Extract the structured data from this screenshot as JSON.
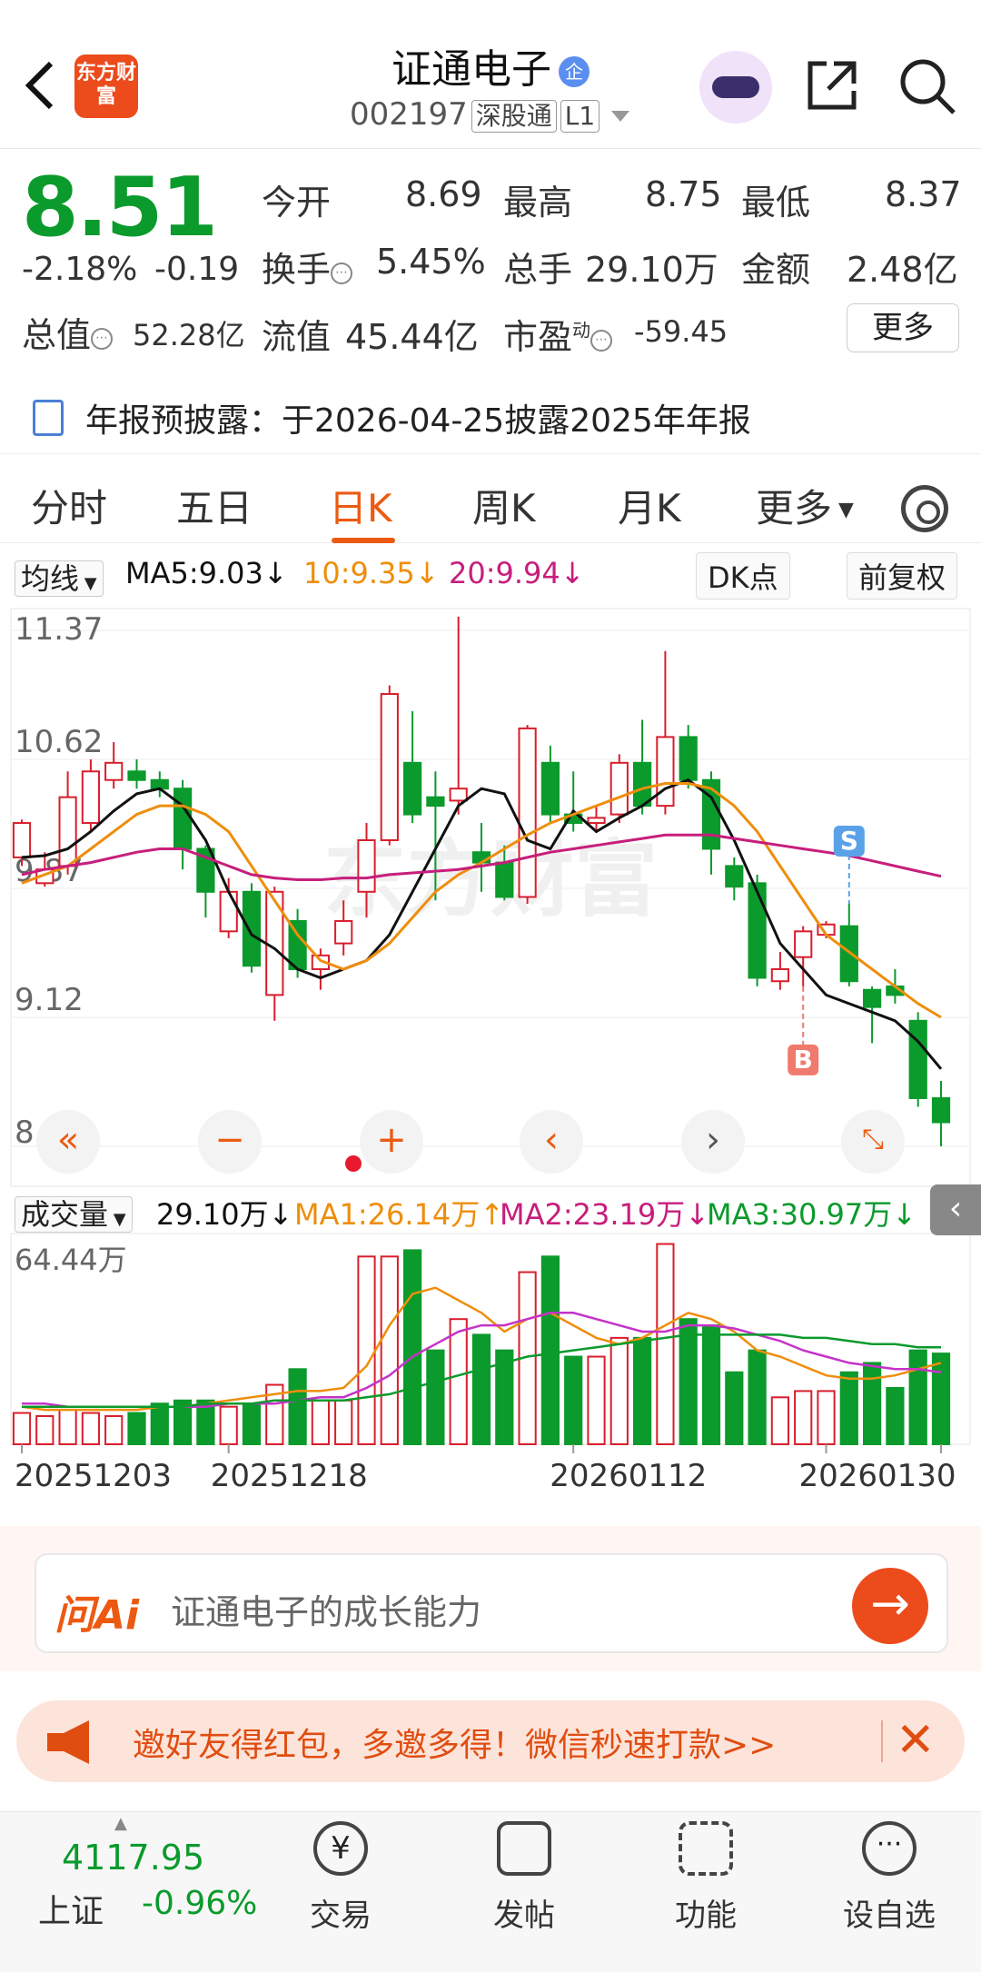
{
  "header": {
    "back_glyph": "back-icon",
    "logo_text": "东方财富",
    "stock_name": "证通电子",
    "qi_badge": "企",
    "stock_code": "002197",
    "market_tag": "深股通",
    "level_tag": "L1"
  },
  "quote": {
    "price": "8.51",
    "change_pct": "-2.18%",
    "change": "-0.19",
    "fields": {
      "open_label": "今开",
      "open": "8.69",
      "high_label": "最高",
      "high": "8.75",
      "low_label": "最低",
      "low": "8.37",
      "turnover_label": "换手",
      "turnover": "5.45%",
      "volume_label": "总手",
      "volume": "29.10万",
      "amount_label": "金额",
      "amount": "2.48亿",
      "mktcap_label": "总值",
      "mktcap": "52.28亿",
      "float_label": "流值",
      "float": "45.44亿",
      "pe_label": "市盈",
      "pe_sup": "动",
      "pe": "-59.45"
    },
    "more_label": "更多"
  },
  "notice": {
    "text": "年报预披露：于2026-04-25披露2025年年报"
  },
  "tabs": [
    "分时",
    "五日",
    "日K",
    "周K",
    "月K",
    "更多"
  ],
  "ma_row": {
    "selector": "均线",
    "ma5": "MA5:9.03↓",
    "ma10": "10:9.35↓",
    "ma20": "20:9.94↓",
    "dk": "DK点",
    "adjust": "前复权"
  },
  "vol_row": {
    "selector": "成交量",
    "vol": "29.10万↓",
    "ma1": "MA1:26.14万↑",
    "ma2": "MA2:23.19万↓",
    "ma3": "MA3:30.97万↓"
  },
  "chart_data": {
    "type": "candlestick",
    "y_axis_labels": [
      "11.37",
      "10.62",
      "9.87",
      "9.12",
      "8.37"
    ],
    "ylim": [
      8.37,
      11.37
    ],
    "volume_axis_label": "64.44万",
    "volume_max": 64.44,
    "x_labels": [
      "20251203",
      "20251218",
      "20260112",
      "20260130"
    ],
    "markers": [
      {
        "label": "S"
      },
      {
        "label": "B"
      }
    ],
    "candles": [
      {
        "o": 10.05,
        "c": 10.25,
        "h": 10.27,
        "l": 10.0,
        "v": 10
      },
      {
        "o": 9.9,
        "c": 9.98,
        "h": 10.08,
        "l": 9.88,
        "v": 9
      },
      {
        "o": 10.0,
        "c": 10.4,
        "h": 10.55,
        "l": 9.95,
        "v": 11
      },
      {
        "o": 10.25,
        "c": 10.55,
        "h": 10.62,
        "l": 10.2,
        "v": 10
      },
      {
        "o": 10.5,
        "c": 10.6,
        "h": 10.72,
        "l": 10.45,
        "v": 9
      },
      {
        "o": 10.55,
        "c": 10.5,
        "h": 10.62,
        "l": 10.45,
        "v": 10
      },
      {
        "o": 10.5,
        "c": 10.45,
        "h": 10.55,
        "l": 10.4,
        "v": 13
      },
      {
        "o": 10.45,
        "c": 10.1,
        "h": 10.5,
        "l": 9.98,
        "v": 14
      },
      {
        "o": 10.1,
        "c": 9.85,
        "h": 10.12,
        "l": 9.7,
        "v": 14
      },
      {
        "o": 9.62,
        "c": 9.85,
        "h": 9.93,
        "l": 9.58,
        "v": 12
      },
      {
        "o": 9.85,
        "c": 9.42,
        "h": 9.9,
        "l": 9.38,
        "v": 13
      },
      {
        "o": 9.25,
        "c": 9.85,
        "h": 9.88,
        "l": 9.1,
        "v": 19
      },
      {
        "o": 9.68,
        "c": 9.4,
        "h": 9.75,
        "l": 9.35,
        "v": 24
      },
      {
        "o": 9.4,
        "c": 9.48,
        "h": 9.52,
        "l": 9.28,
        "v": 14
      },
      {
        "o": 9.55,
        "c": 9.68,
        "h": 9.8,
        "l": 9.48,
        "v": 14
      },
      {
        "o": 9.85,
        "c": 10.15,
        "h": 10.25,
        "l": 9.7,
        "v": 60
      },
      {
        "o": 10.15,
        "c": 11.0,
        "h": 11.05,
        "l": 10.12,
        "v": 60
      },
      {
        "o": 10.6,
        "c": 10.3,
        "h": 10.9,
        "l": 10.25,
        "v": 62
      },
      {
        "o": 10.4,
        "c": 10.35,
        "h": 10.55,
        "l": 9.8,
        "v": 30
      },
      {
        "o": 10.38,
        "c": 10.45,
        "h": 11.45,
        "l": 10.3,
        "v": 40
      },
      {
        "o": 10.08,
        "c": 10.02,
        "h": 10.25,
        "l": 9.85,
        "v": 35
      },
      {
        "o": 10.02,
        "c": 9.82,
        "h": 10.12,
        "l": 9.8,
        "v": 30
      },
      {
        "o": 9.82,
        "c": 10.8,
        "h": 10.82,
        "l": 9.78,
        "v": 55
      },
      {
        "o": 10.6,
        "c": 10.3,
        "h": 10.7,
        "l": 10.25,
        "v": 60
      },
      {
        "o": 10.3,
        "c": 10.25,
        "h": 10.55,
        "l": 10.2,
        "v": 28
      },
      {
        "o": 10.25,
        "c": 10.28,
        "h": 10.35,
        "l": 10.2,
        "v": 28
      },
      {
        "o": 10.3,
        "c": 10.6,
        "h": 10.65,
        "l": 10.25,
        "v": 34
      },
      {
        "o": 10.6,
        "c": 10.35,
        "h": 10.85,
        "l": 10.3,
        "v": 34
      },
      {
        "o": 10.35,
        "c": 10.75,
        "h": 11.25,
        "l": 10.3,
        "v": 64
      },
      {
        "o": 10.75,
        "c": 10.5,
        "h": 10.82,
        "l": 10.45,
        "v": 40
      },
      {
        "o": 10.5,
        "c": 10.1,
        "h": 10.55,
        "l": 9.95,
        "v": 38
      },
      {
        "o": 10.0,
        "c": 9.88,
        "h": 10.05,
        "l": 9.8,
        "v": 23
      },
      {
        "o": 9.9,
        "c": 9.35,
        "h": 9.95,
        "l": 9.3,
        "v": 30
      },
      {
        "o": 9.33,
        "c": 9.4,
        "h": 9.5,
        "l": 9.28,
        "v": 15
      },
      {
        "o": 9.47,
        "c": 9.62,
        "h": 9.65,
        "l": 9.3,
        "v": 17
      },
      {
        "o": 9.6,
        "c": 9.66,
        "h": 9.68,
        "l": 9.58,
        "v": 17
      },
      {
        "o": 9.65,
        "c": 9.33,
        "h": 9.78,
        "l": 9.3,
        "v": 23
      },
      {
        "o": 9.28,
        "c": 9.18,
        "h": 9.3,
        "l": 8.97,
        "v": 26
      },
      {
        "o": 9.3,
        "c": 9.25,
        "h": 9.4,
        "l": 9.2,
        "v": 18
      },
      {
        "o": 9.1,
        "c": 8.65,
        "h": 9.15,
        "l": 8.6,
        "v": 30
      },
      {
        "o": 8.65,
        "c": 8.51,
        "h": 8.75,
        "l": 8.37,
        "v": 29
      }
    ],
    "ma5": [
      10.05,
      10.06,
      10.1,
      10.2,
      10.32,
      10.42,
      10.45,
      10.35,
      10.15,
      9.85,
      9.6,
      9.52,
      9.4,
      9.35,
      9.4,
      9.45,
      9.6,
      9.85,
      10.1,
      10.35,
      10.45,
      10.42,
      10.15,
      10.1,
      10.32,
      10.2,
      10.28,
      10.35,
      10.45,
      10.5,
      10.4,
      10.15,
      9.85,
      9.55,
      9.4,
      9.25,
      9.2,
      9.15,
      9.1,
      8.98,
      8.82
    ],
    "ma10": [
      9.9,
      9.95,
      10.0,
      10.1,
      10.2,
      10.3,
      10.35,
      10.35,
      10.3,
      10.2,
      10.0,
      9.8,
      9.6,
      9.45,
      9.4,
      9.45,
      9.55,
      9.7,
      9.85,
      9.95,
      10.02,
      10.1,
      10.18,
      10.25,
      10.3,
      10.35,
      10.4,
      10.45,
      10.48,
      10.48,
      10.45,
      10.35,
      10.2,
      10.0,
      9.8,
      9.6,
      9.5,
      9.4,
      9.3,
      9.2,
      9.12
    ],
    "ma20": [
      9.95,
      9.98,
      10.0,
      10.02,
      10.05,
      10.08,
      10.1,
      10.1,
      10.05,
      10.0,
      9.95,
      9.93,
      9.92,
      9.92,
      9.93,
      9.93,
      9.95,
      9.96,
      9.97,
      9.98,
      10.0,
      10.02,
      10.05,
      10.08,
      10.1,
      10.12,
      10.14,
      10.16,
      10.18,
      10.18,
      10.18,
      10.16,
      10.14,
      10.12,
      10.1,
      10.08,
      10.06,
      10.03,
      10.0,
      9.97,
      9.94
    ],
    "vma1": [
      12,
      11,
      11,
      11,
      11,
      11,
      12,
      12,
      13,
      14,
      15,
      16,
      17,
      17,
      18,
      25,
      38,
      48,
      50,
      46,
      42,
      36,
      40,
      42,
      38,
      34,
      32,
      34,
      38,
      42,
      40,
      36,
      30,
      28,
      25,
      22,
      21,
      21,
      22,
      24,
      26
    ],
    "vma2": [
      13,
      13,
      12,
      12,
      12,
      12,
      12,
      12,
      12,
      13,
      13,
      13,
      14,
      15,
      15,
      18,
      22,
      28,
      32,
      36,
      38,
      38,
      40,
      42,
      42,
      40,
      38,
      36,
      36,
      38,
      38,
      37,
      35,
      33,
      30,
      28,
      26,
      25,
      24,
      24,
      23
    ],
    "vma3": [
      12,
      12,
      12,
      12,
      12,
      12,
      12,
      12,
      13,
      13,
      13,
      14,
      14,
      14,
      14,
      15,
      16,
      18,
      20,
      22,
      24,
      26,
      28,
      29,
      30,
      31,
      32,
      33,
      34,
      35,
      35,
      35,
      35,
      35,
      34,
      34,
      33,
      32,
      32,
      31,
      31
    ]
  },
  "ai": {
    "logo": "问Ai",
    "placeholder": "证通电子的成长能力"
  },
  "promo": {
    "text": "邀好友得红包，多邀多得！微信秒速打款>>"
  },
  "bottom": {
    "index_value": "4117.95",
    "index_name": "上证",
    "index_change": "-0.96%",
    "items": [
      "交易",
      "发帖",
      "功能",
      "设自选"
    ]
  },
  "watermark": "东方财富",
  "colors": {
    "up": "#d81e2c",
    "down": "#0b9a2c",
    "accent": "#ec5a11",
    "ma5": "#111111",
    "ma10": "#ee8e0c",
    "ma20": "#c71e7c"
  }
}
